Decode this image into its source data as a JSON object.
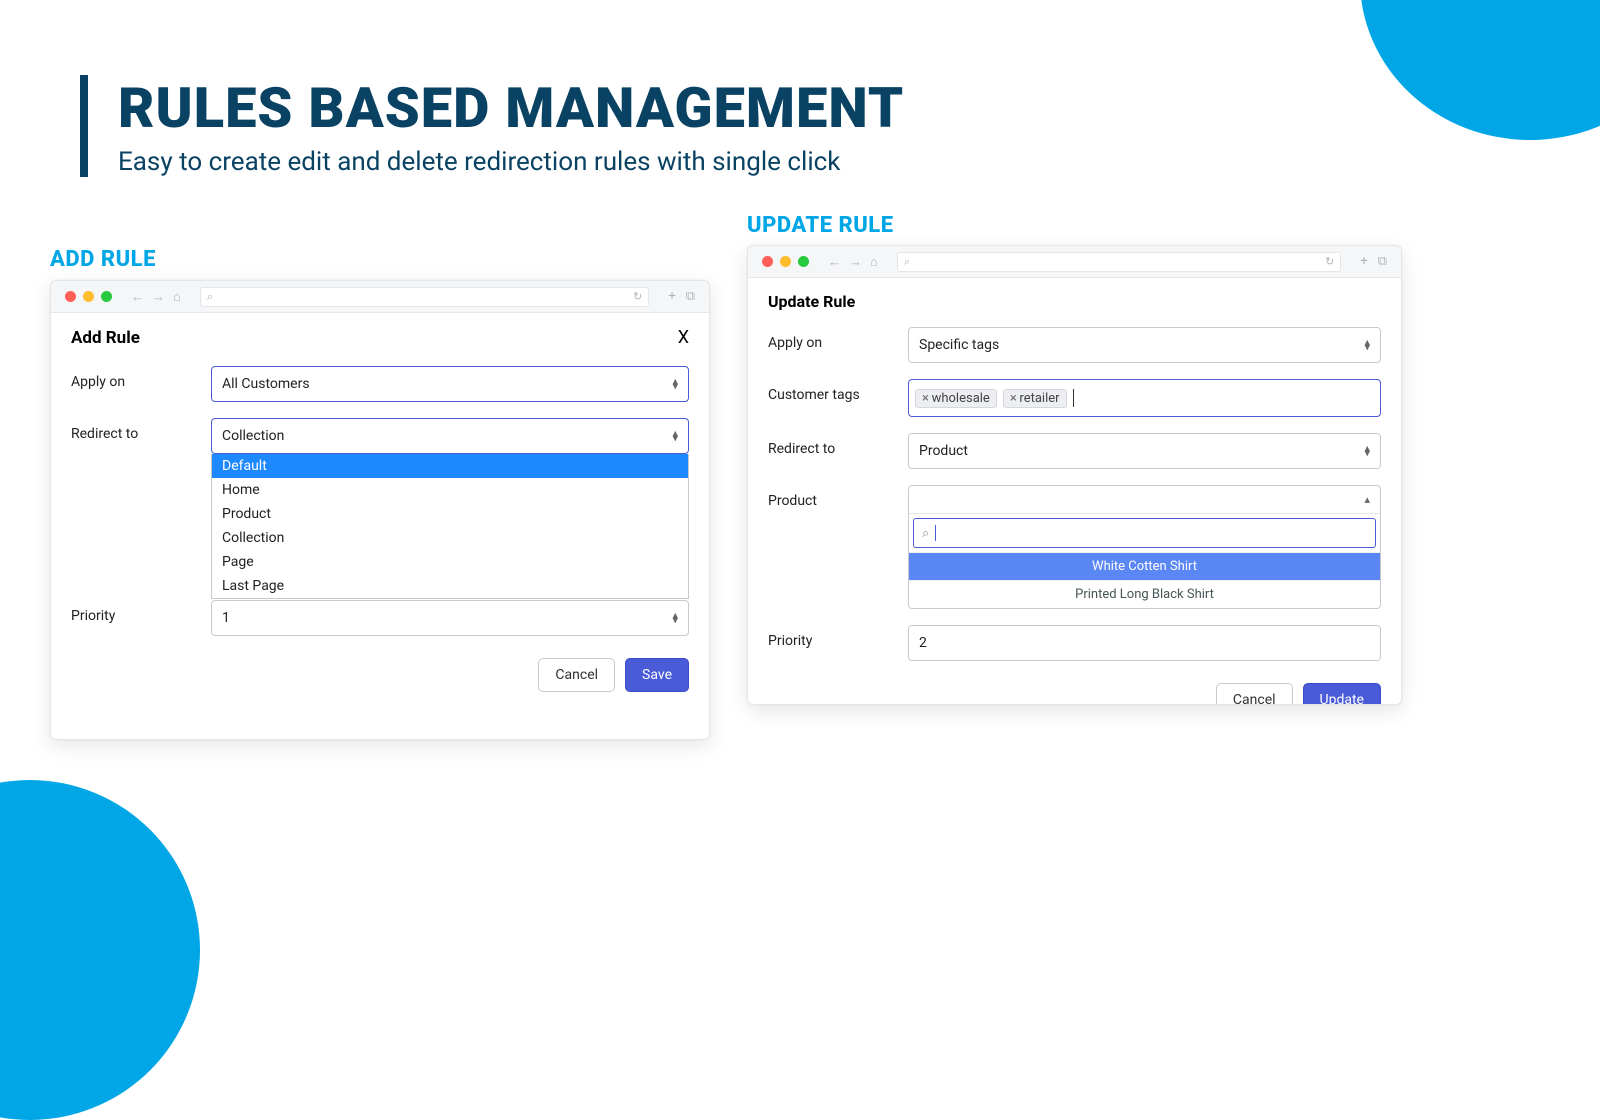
{
  "heading": {
    "title": "RULES BASED MANAGEMENT",
    "subtitle": "Easy to create edit and delete redirection rules with single click"
  },
  "sections": {
    "add_label": "ADD RULE",
    "update_label": "UPDATE RULE"
  },
  "add_rule": {
    "dialog_title": "Add Rule",
    "labels": {
      "apply_on": "Apply on",
      "redirect_to": "Redirect to",
      "priority": "Priority"
    },
    "apply_on_value": "All Customers",
    "redirect_to_value": "Collection",
    "redirect_options": [
      "Default",
      "Home",
      "Product",
      "Collection",
      "Page",
      "Last Page"
    ],
    "redirect_highlight_index": 0,
    "priority_value": "1",
    "buttons": {
      "cancel": "Cancel",
      "save": "Save"
    }
  },
  "update_rule": {
    "dialog_title": "Update Rule",
    "labels": {
      "apply_on": "Apply on",
      "customer_tags": "Customer tags",
      "redirect_to": "Redirect to",
      "product": "Product",
      "priority": "Priority"
    },
    "apply_on_value": "Specific tags",
    "tags": [
      "wholesale",
      "retailer"
    ],
    "redirect_to_value": "Product",
    "product_options": [
      "White Cotten Shirt",
      "Printed Long Black Shirt"
    ],
    "product_highlight_index": 0,
    "priority_value": "2",
    "buttons": {
      "cancel": "Cancel",
      "update": "Update"
    }
  }
}
